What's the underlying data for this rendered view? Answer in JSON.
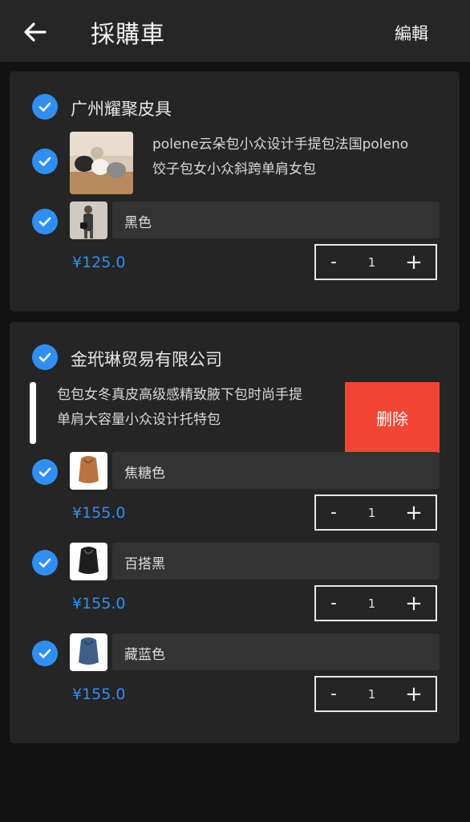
{
  "header": {
    "title": "採購車",
    "edit_label": "編輯"
  },
  "stores": [
    {
      "name": "广州耀聚皮具",
      "product": {
        "title_line1": "polene云朵包小众设计手提包法国poleno",
        "title_line2": "饺子包女小众斜跨单肩女包",
        "variants": [
          {
            "label": "黑色",
            "price": "¥125.0",
            "quantity": "1"
          }
        ]
      }
    },
    {
      "name": "金玳琳贸易有限公司",
      "product": {
        "title_line1": "包包女冬真皮高级感精致腋下包时尚手提",
        "title_line2": "单肩大容量小众设计托特包",
        "delete_label": "删除",
        "variants": [
          {
            "label": "焦糖色",
            "price": "¥155.0",
            "quantity": "1"
          },
          {
            "label": "百搭黑",
            "price": "¥155.0",
            "quantity": "1"
          },
          {
            "label": "藏蓝色",
            "price": "¥155.0",
            "quantity": "1"
          }
        ]
      }
    }
  ],
  "stepper": {
    "minus": "-",
    "plus": "+"
  },
  "colors": {
    "accent": "#2f8ff5",
    "delete": "#f24535",
    "card": "#252525",
    "header": "#262626"
  }
}
